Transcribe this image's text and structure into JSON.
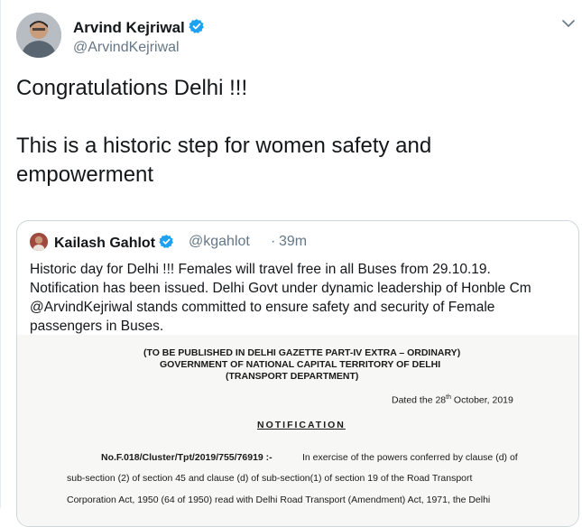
{
  "author": {
    "name": "Arvind Kejriwal",
    "handle": "@ArvindKejriwal"
  },
  "tweet": {
    "line1": "Congratulations Delhi !!!",
    "line2": "This is a historic step for women safety and",
    "line3": "empowerment"
  },
  "quoted": {
    "name": "Kailash Gahlot",
    "handle": "@kgahlot",
    "dot": "·",
    "time": "39m",
    "lines": [
      "Historic day for Delhi !!! Females will travel free in all Buses from 29.10.19.",
      "Notification has been issued. Delhi Govt under dynamic leadership of Honble Cm",
      "@ArvindKejriwal stands committed to ensure safety and security of Female",
      "passengers in Buses."
    ],
    "document": {
      "header1": "(TO BE PUBLISHED IN DELHI GAZETTE PART-IV EXTRA – ORDINARY)",
      "header2": "GOVERNMENT OF NATIONAL CAPITAL TERRITORY OF DELHI",
      "header3": "(TRANSPORT DEPARTMENT)",
      "date_prefix": "Dated the 28",
      "date_sup": "th",
      "date_suffix": " October, 2019",
      "notification": "NOTIFICATION",
      "ref": "No.F.018/Cluster/Tpt/2019/755/76919 :-",
      "body1": "In exercise of the powers conferred by clause (d) of",
      "body2": "sub-section (2) of section 45 and clause (d) of sub-section(1) of section 19 of the Road Transport",
      "body3": "Corporation Act, 1950 (64 of 1950)  read with Delhi Road Transport (Amendment) Act, 1971, the Delhi"
    }
  },
  "icons": {
    "verified": "verified-badge-icon",
    "caret": "chevron-down-icon"
  },
  "colors": {
    "verified": "#1da1f2",
    "text": "#14171a",
    "secondary": "#657786",
    "border": "#ccd6dd"
  }
}
